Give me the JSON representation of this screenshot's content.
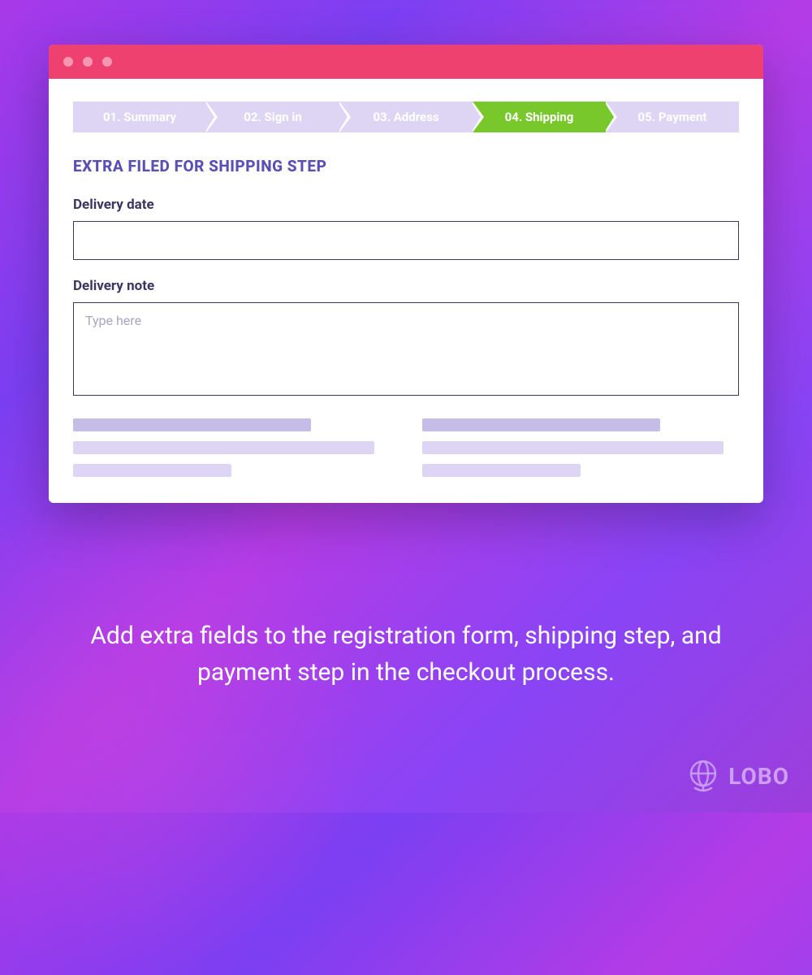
{
  "steps": [
    {
      "label": "01. Summary",
      "active": false
    },
    {
      "label": "02. Sign in",
      "active": false
    },
    {
      "label": "03. Address",
      "active": false
    },
    {
      "label": "04. Shipping",
      "active": true
    },
    {
      "label": "05. Payment",
      "active": false
    }
  ],
  "section_title": "EXTRA FILED FOR SHIPPING STEP",
  "fields": {
    "delivery_date_label": "Delivery date",
    "delivery_note_label": "Delivery note",
    "delivery_note_placeholder": "Type here"
  },
  "caption": "Add extra fields to the registration form, shipping step, and payment step in the checkout process.",
  "brand": "LOBO"
}
